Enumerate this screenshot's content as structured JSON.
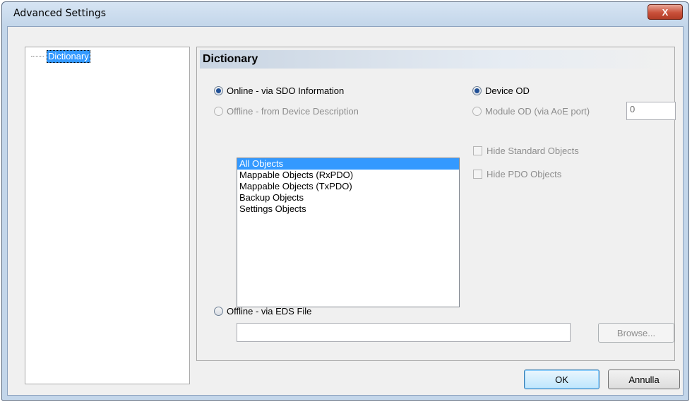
{
  "window": {
    "title": "Advanced Settings",
    "close_label": "X"
  },
  "tree": {
    "items": [
      {
        "label": "Dictionary",
        "selected": true
      }
    ]
  },
  "panel": {
    "header": "Dictionary",
    "online_sdo": {
      "label": "Online - via SDO Information",
      "checked": true
    },
    "offline_device_desc": {
      "label": "Offline - from Device Description",
      "checked": false,
      "disabled": true
    },
    "device_od": {
      "label": "Device OD",
      "checked": true
    },
    "module_od": {
      "label": "Module OD (via AoE port)",
      "checked": false,
      "disabled": true
    },
    "module_port_value": "0",
    "object_list": [
      {
        "label": "All Objects",
        "selected": true
      },
      {
        "label": "Mappable Objects (RxPDO)"
      },
      {
        "label": "Mappable Objects (TxPDO)"
      },
      {
        "label": "Backup Objects"
      },
      {
        "label": "Settings Objects"
      }
    ],
    "hide_standard": {
      "label": "Hide Standard Objects",
      "checked": false,
      "disabled": true
    },
    "hide_pdo": {
      "label": "Hide PDO Objects",
      "checked": false,
      "disabled": true
    },
    "offline_eds": {
      "label": "Offline - via EDS File",
      "checked": false
    },
    "eds_path_value": "",
    "browse_label": "Browse..."
  },
  "footer": {
    "ok_label": "OK",
    "cancel_label": "Annulla"
  }
}
